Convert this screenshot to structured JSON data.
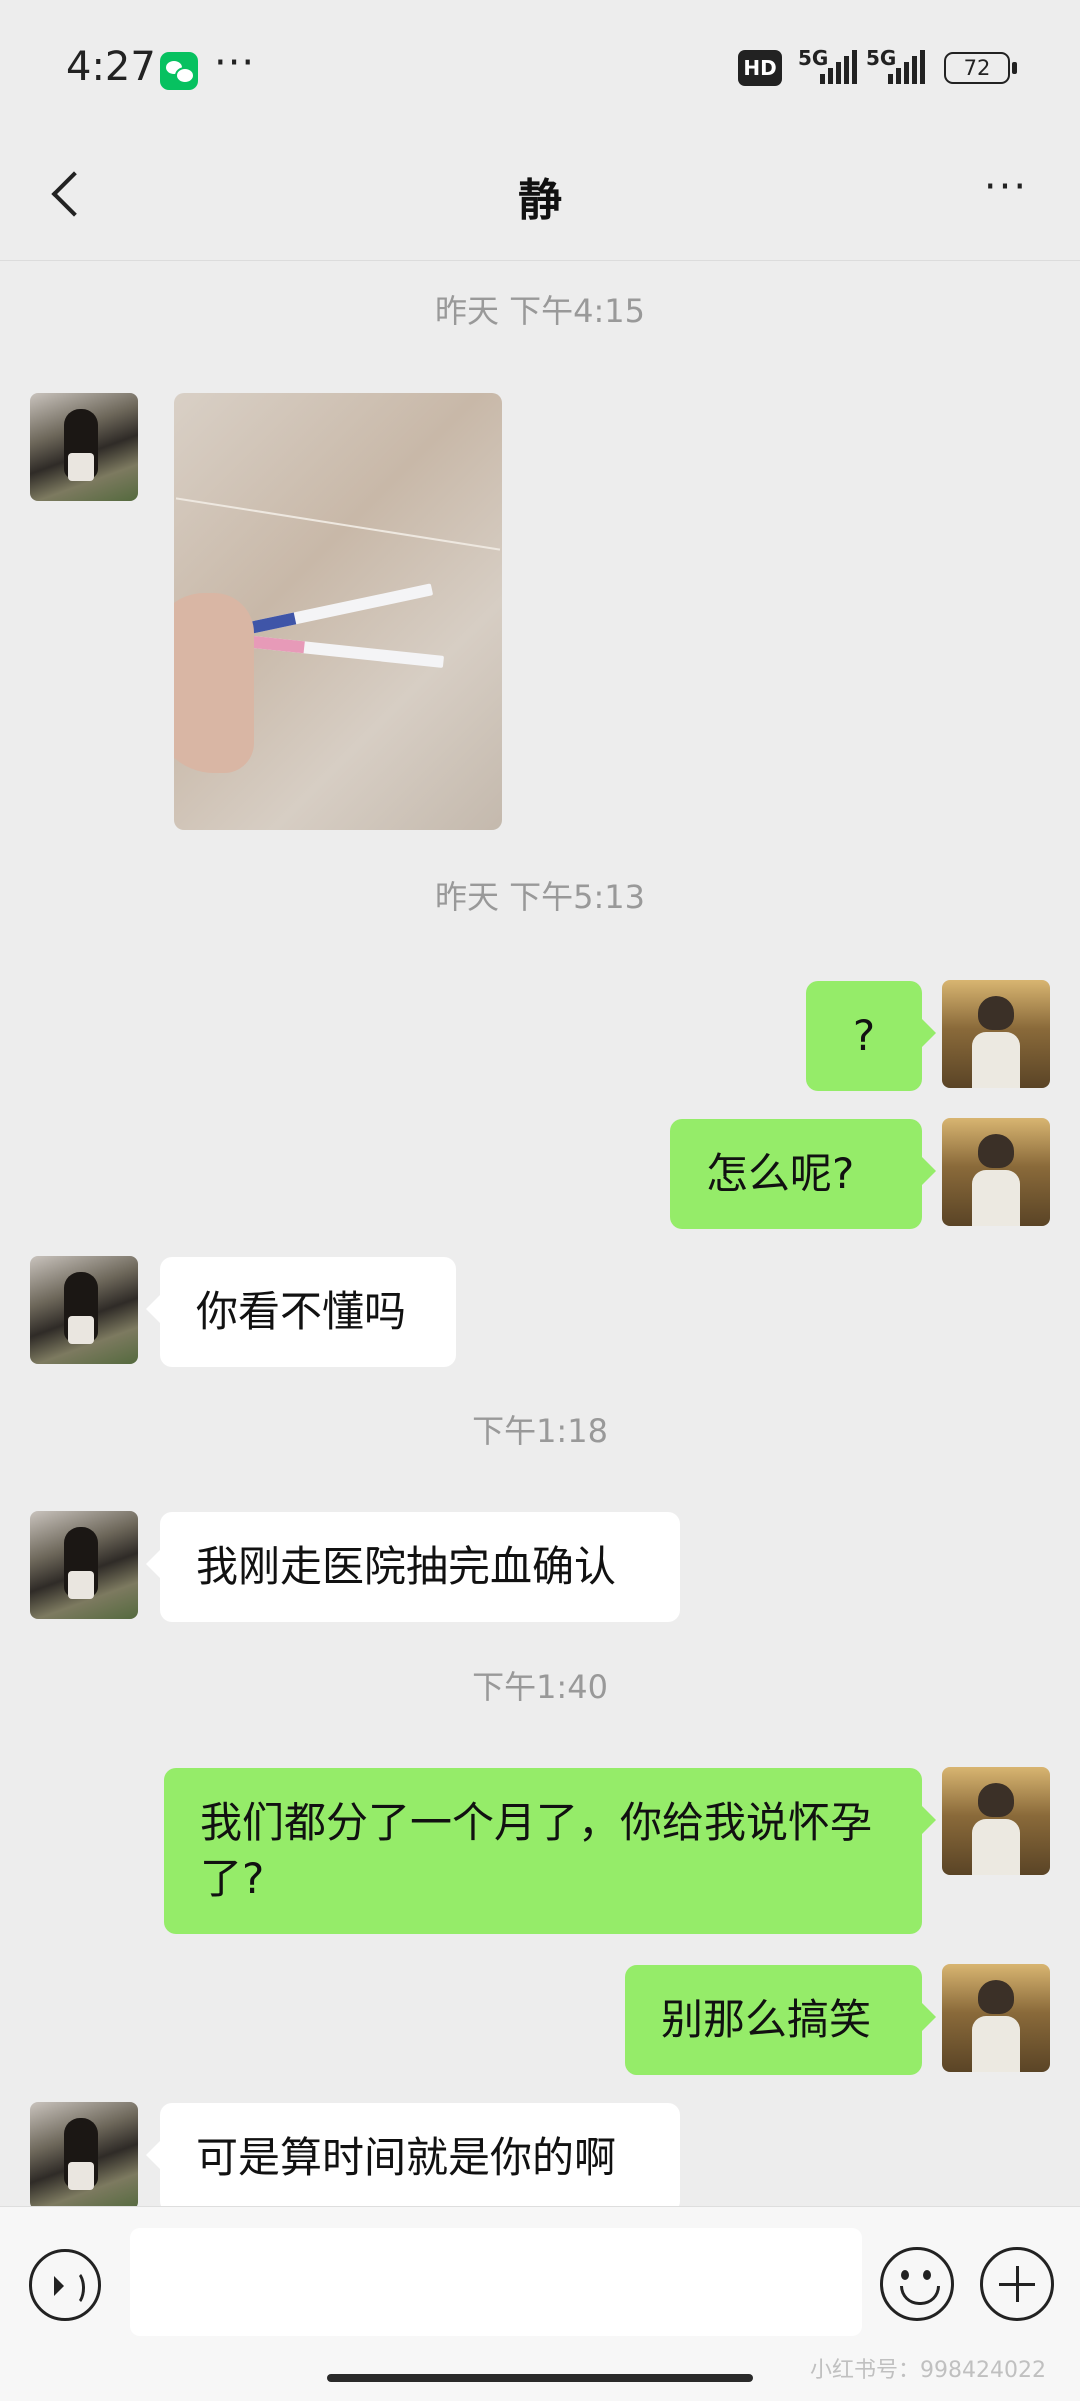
{
  "status_bar": {
    "time": "4:27",
    "app_icon": "wechat-icon",
    "more_dots": "···",
    "hd_label": "HD",
    "network_1": "5G",
    "network_2": "5G",
    "battery": "72"
  },
  "header": {
    "title": "静",
    "back_icon": "chevron-left-icon",
    "more_icon": "···"
  },
  "chat": {
    "timestamps": [
      "昨天 下午4:15",
      "昨天 下午5:13",
      "下午1:18",
      "下午1:40"
    ],
    "messages": [
      {
        "side": "left",
        "type": "image",
        "text": ""
      },
      {
        "side": "right",
        "type": "text",
        "text": "?"
      },
      {
        "side": "right",
        "type": "text",
        "text": "怎么呢?"
      },
      {
        "side": "left",
        "type": "text",
        "text": "你看不懂吗"
      },
      {
        "side": "left",
        "type": "text",
        "text": "我刚走医院抽完血确认"
      },
      {
        "side": "right",
        "type": "text",
        "text": "我们都分了一个月了，你给我说怀孕了?"
      },
      {
        "side": "right",
        "type": "text",
        "text": "别那么搞笑"
      },
      {
        "side": "left",
        "type": "text",
        "text": "可是算时间就是你的啊"
      }
    ]
  },
  "input_bar": {
    "voice_icon": "voice-icon",
    "emoji_icon": "emoji-icon",
    "plus_icon": "plus-icon",
    "input_value": ""
  },
  "watermark": "小红书号：998424022",
  "colors": {
    "background": "#ededed",
    "sent_bubble": "#95ec69",
    "received_bubble": "#ffffff",
    "timestamp_text": "#999999"
  }
}
